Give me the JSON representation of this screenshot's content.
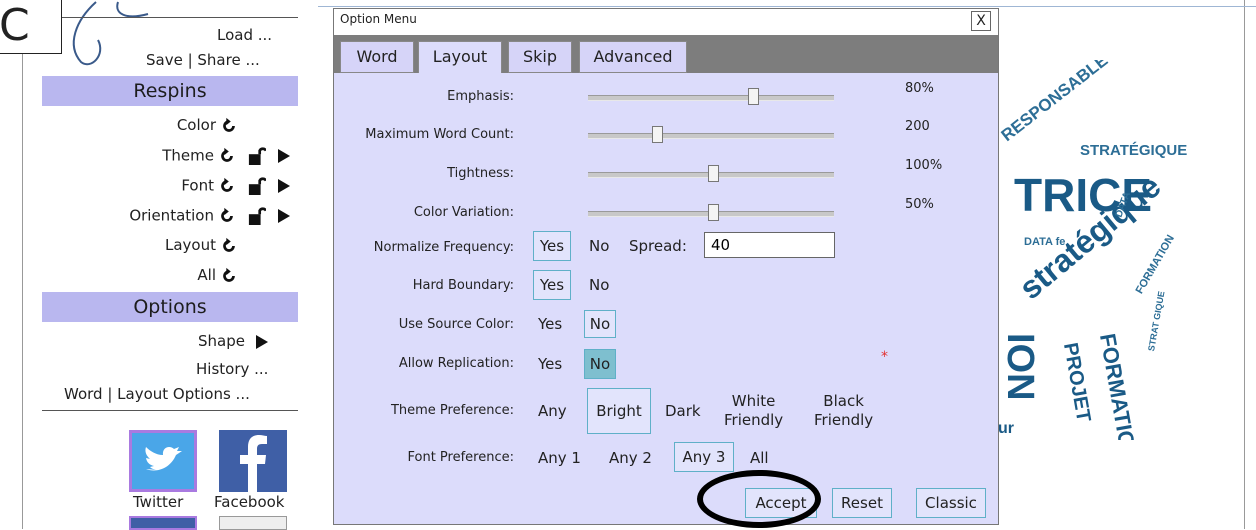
{
  "sidebar": {
    "badge": "C",
    "load": "Load ...",
    "save_share": "Save | Share ...",
    "respins_header": "Respins",
    "respins": [
      {
        "label": "Color",
        "has_lock": false,
        "has_arrow": false
      },
      {
        "label": "Theme",
        "has_lock": true,
        "has_arrow": true
      },
      {
        "label": "Font",
        "has_lock": true,
        "has_arrow": true
      },
      {
        "label": "Orientation",
        "has_lock": true,
        "has_arrow": true
      },
      {
        "label": "Layout",
        "has_lock": false,
        "has_arrow": false
      },
      {
        "label": "All",
        "has_lock": false,
        "has_arrow": false
      }
    ],
    "options_header": "Options",
    "shape": "Shape",
    "history": "History ...",
    "word_layout": "Word | Layout Options ...",
    "twitter": "Twitter",
    "facebook": "Facebook"
  },
  "dialog": {
    "title": "Option Menu",
    "close": "X",
    "tabs": [
      "Word",
      "Layout",
      "Skip",
      "Advanced"
    ],
    "active_tab": "Layout",
    "sliders": [
      {
        "label": "Emphasis:",
        "value": "80%",
        "position": 0.67
      },
      {
        "label": "Maximum Word Count:",
        "value": "200",
        "position": 0.28
      },
      {
        "label": "Tightness:",
        "value": "100%",
        "position": 0.51
      },
      {
        "label": "Color Variation:",
        "value": "50%",
        "position": 0.51
      }
    ],
    "normalize": {
      "label": "Normalize Frequency:",
      "yes": "Yes",
      "no": "No",
      "spread_label": "Spread:",
      "spread_value": "40",
      "selected": "Yes"
    },
    "hard_boundary": {
      "label": "Hard Boundary:",
      "yes": "Yes",
      "no": "No",
      "selected": "Yes"
    },
    "use_source_color": {
      "label": "Use Source Color:",
      "yes": "Yes",
      "no": "No",
      "selected": "No"
    },
    "allow_replication": {
      "label": "Allow Replication:",
      "yes": "Yes",
      "no": "No",
      "selected": "No",
      "marker": "*"
    },
    "theme_preference": {
      "label": "Theme Preference:",
      "options": [
        "Any",
        "Bright",
        "Dark",
        "White\nFriendly",
        "Black\nFriendly"
      ],
      "selected": "Bright"
    },
    "font_preference": {
      "label": "Font Preference:",
      "options": [
        "Any 1",
        "Any 2",
        "Any 3",
        "All"
      ],
      "selected": "Any 3"
    },
    "buttons": {
      "accept": "Accept",
      "reset": "Reset",
      "classic": "Classic"
    }
  },
  "wordcloud": {
    "words": [
      "RESPONSABLE",
      "STRATÉGIQUE",
      "TRICE",
      "stratégique",
      "FORMATION",
      "PROJET",
      "DATA",
      "FORMATION",
      "STRAT GIQUE",
      "STRAT",
      "DATA fe",
      "ION",
      "ur",
      "GIQUE"
    ]
  },
  "colors": {
    "dialog_bg": "#dcdcfb",
    "header_bg": "#b9b7ef",
    "tabbar": "#7d7d7d",
    "selected_fill": "#7ebfcf",
    "selected_border": "#5fb0c8",
    "wordcloud": "#1e5f8a"
  }
}
